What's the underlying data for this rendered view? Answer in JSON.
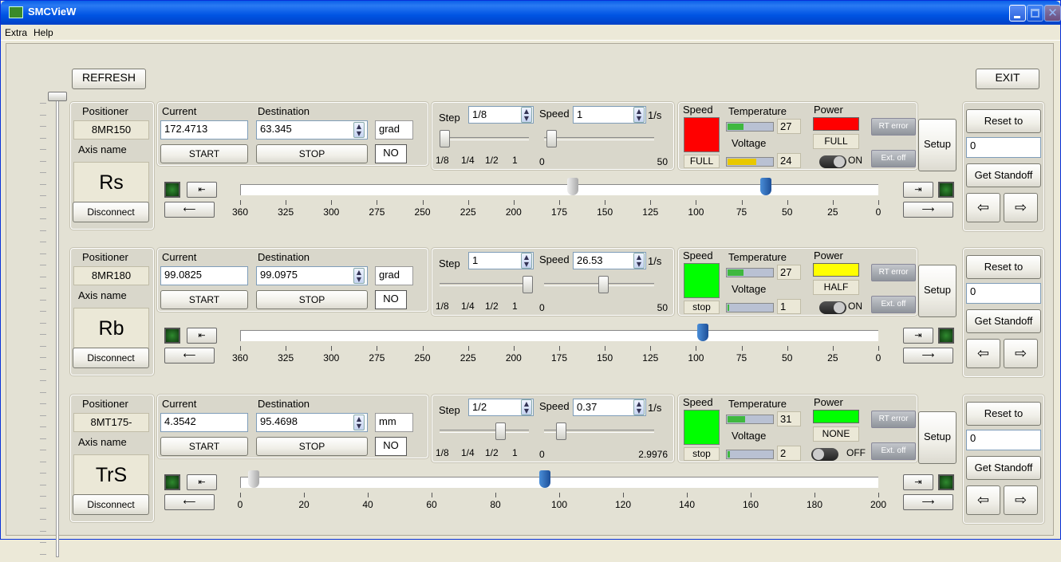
{
  "window": {
    "title": "SMCVieW"
  },
  "menu": [
    "Extra",
    "Help"
  ],
  "buttons": {
    "refresh": "REFRESH",
    "exit": "EXIT"
  },
  "labels": {
    "positioner": "Positioner",
    "axis_name": "Axis name",
    "current": "Current",
    "destination": "Destination",
    "start": "START",
    "stop": "STOP",
    "disconnect": "Disconnect",
    "step": "Step",
    "speed": "Speed",
    "speed_unit": "1/s",
    "temperature": "Temperature",
    "voltage": "Voltage",
    "power": "Power",
    "rt_error": "RT error",
    "ext_off": "Ext. off",
    "setup": "Setup",
    "reset_to": "Reset to",
    "get_standoff": "Get Standoff",
    "step_marks": [
      "1/8",
      "1/4",
      "1/2",
      "1"
    ],
    "speed_min": "0"
  },
  "axes": [
    {
      "positioner": "8MR150",
      "axis_name": "Rs",
      "current": "172.4713",
      "destination": "63.345",
      "unit": "grad",
      "no_label": "NO",
      "step": "1/8",
      "step_level": 0,
      "speed": "1",
      "speed_level": 0.02,
      "speed_max": "50",
      "speed_color": "#ff0000",
      "speed_state": "FULL",
      "temperature": "27",
      "temp_level": 0.35,
      "temp_color": "#3fb83f",
      "voltage": "24",
      "voltage_level": 0.65,
      "voltage_color": "#e8c800",
      "power_color": "#ff0000",
      "power_state": "FULL",
      "switch": "ON",
      "switch_on": true,
      "reset_value": "0",
      "scale": [
        "360",
        "325",
        "300",
        "275",
        "250",
        "225",
        "200",
        "175",
        "150",
        "125",
        "100",
        "75",
        "50",
        "25",
        "0"
      ],
      "scale_min": 360,
      "scale_max": 0,
      "current_marker": 172.4713,
      "destination_marker": 63.345
    },
    {
      "positioner": "8MR180",
      "axis_name": "Rb",
      "current": "99.0825",
      "destination": "99.0975",
      "unit": "grad",
      "no_label": "NO",
      "step": "1",
      "step_level": 1,
      "speed": "26.53",
      "speed_level": 0.53,
      "speed_max": "50",
      "speed_color": "#00ff00",
      "speed_state": "stop",
      "temperature": "27",
      "temp_level": 0.35,
      "temp_color": "#3fb83f",
      "voltage": "1",
      "voltage_level": 0.04,
      "voltage_color": "#3fb83f",
      "power_color": "#ffff00",
      "power_state": "HALF",
      "switch": "ON",
      "switch_on": true,
      "reset_value": "0",
      "scale": [
        "360",
        "325",
        "300",
        "275",
        "250",
        "225",
        "200",
        "175",
        "150",
        "125",
        "100",
        "75",
        "50",
        "25",
        "0"
      ],
      "scale_min": 360,
      "scale_max": 0,
      "current_marker": 99.0825,
      "destination_marker": 99.0975
    },
    {
      "positioner": "8MT175-",
      "axis_name": "TrS",
      "current": "4.3542",
      "destination": "95.4698",
      "unit": "mm",
      "no_label": "NO",
      "step": "1/2",
      "step_level": 0.67,
      "speed": "0.37",
      "speed_level": 0.12,
      "speed_max": "2.9976",
      "speed_color": "#00ff00",
      "speed_state": "stop",
      "temperature": "31",
      "temp_level": 0.4,
      "temp_color": "#3fb83f",
      "voltage": "2",
      "voltage_level": 0.05,
      "voltage_color": "#3fb83f",
      "power_color": "#00ff00",
      "power_state": "NONE",
      "switch": "OFF",
      "switch_on": false,
      "reset_value": "0",
      "scale": [
        "0",
        "20",
        "40",
        "60",
        "80",
        "100",
        "120",
        "140",
        "160",
        "180",
        "200"
      ],
      "scale_min": 0,
      "scale_max": 200,
      "current_marker": 4.3542,
      "destination_marker": 95.4698
    }
  ]
}
